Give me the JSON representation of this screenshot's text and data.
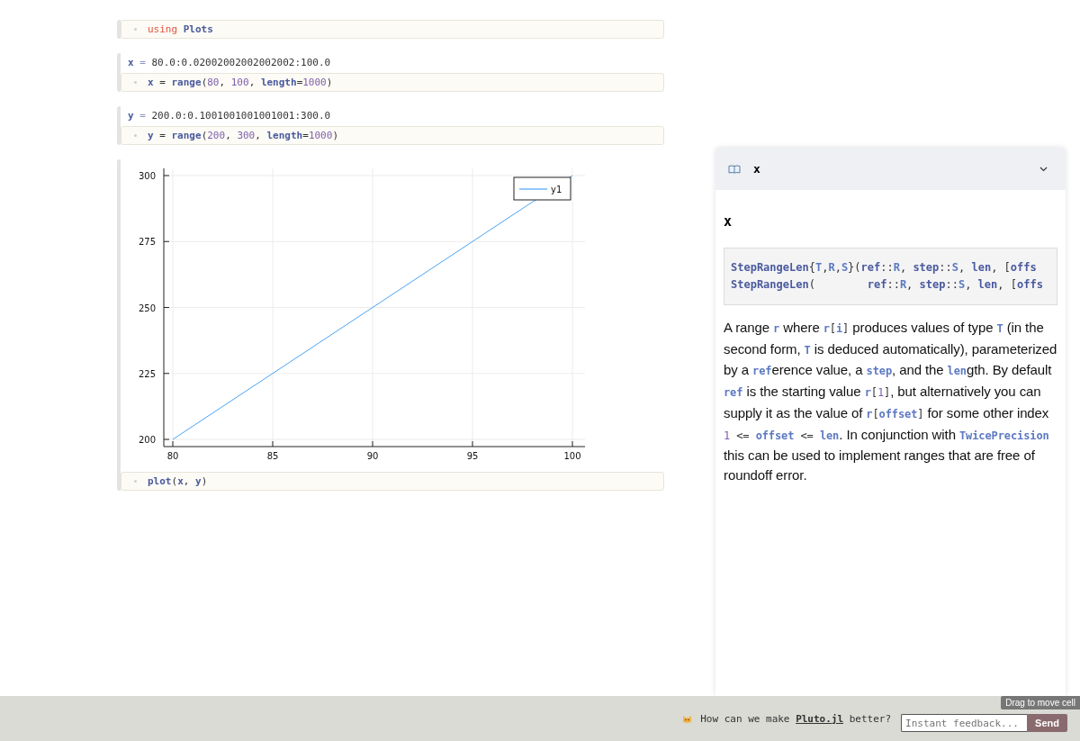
{
  "cells": [
    {
      "input": [
        {
          "kind": "keyword",
          "text": "using "
        },
        {
          "kind": "name",
          "text": "Plots"
        }
      ]
    },
    {
      "output": [
        {
          "kind": "name",
          "text": "x"
        },
        {
          "kind": "op",
          "text": " = "
        },
        {
          "kind": "plain",
          "text": "80.0:0.02002002002002002:100.0"
        }
      ],
      "input": [
        {
          "kind": "name",
          "text": "x"
        },
        {
          "kind": "plain",
          "text": " = "
        },
        {
          "kind": "name",
          "text": "range"
        },
        {
          "kind": "plain",
          "text": "("
        },
        {
          "kind": "number",
          "text": "80"
        },
        {
          "kind": "plain",
          "text": ", "
        },
        {
          "kind": "number",
          "text": "100"
        },
        {
          "kind": "plain",
          "text": ", "
        },
        {
          "kind": "name",
          "text": "length"
        },
        {
          "kind": "plain",
          "text": "="
        },
        {
          "kind": "number",
          "text": "1000"
        },
        {
          "kind": "plain",
          "text": ")"
        }
      ]
    },
    {
      "output": [
        {
          "kind": "name",
          "text": "y"
        },
        {
          "kind": "op",
          "text": " = "
        },
        {
          "kind": "plain",
          "text": "200.0:0.1001001001001001:300.0"
        }
      ],
      "input": [
        {
          "kind": "name",
          "text": "y"
        },
        {
          "kind": "plain",
          "text": " = "
        },
        {
          "kind": "name",
          "text": "range"
        },
        {
          "kind": "plain",
          "text": "("
        },
        {
          "kind": "number",
          "text": "200"
        },
        {
          "kind": "plain",
          "text": ", "
        },
        {
          "kind": "number",
          "text": "300"
        },
        {
          "kind": "plain",
          "text": ", "
        },
        {
          "kind": "name",
          "text": "length"
        },
        {
          "kind": "plain",
          "text": "="
        },
        {
          "kind": "number",
          "text": "1000"
        },
        {
          "kind": "plain",
          "text": ")"
        }
      ]
    },
    {
      "chart_data": {
        "type": "line",
        "grid": true,
        "x": [
          80,
          100
        ],
        "series": [
          {
            "name": "y1",
            "color": "#4aa3f5",
            "values": [
              200,
              300
            ]
          }
        ],
        "xlim": [
          80,
          100
        ],
        "ylim": [
          200,
          300
        ],
        "xticks": [
          80,
          85,
          90,
          95,
          100
        ],
        "yticks": [
          200,
          225,
          250,
          275,
          300
        ]
      },
      "input": [
        {
          "kind": "name",
          "text": "plot"
        },
        {
          "kind": "plain",
          "text": "("
        },
        {
          "kind": "name",
          "text": "x"
        },
        {
          "kind": "plain",
          "text": ", "
        },
        {
          "kind": "name",
          "text": "y"
        },
        {
          "kind": "plain",
          "text": ")"
        }
      ]
    }
  ],
  "docs": {
    "title": "x",
    "heading": "x",
    "signature": [
      [
        {
          "kind": "name",
          "text": "StepRangeLen"
        },
        {
          "kind": "plain",
          "text": "{"
        },
        {
          "kind": "type",
          "text": "T"
        },
        {
          "kind": "plain",
          "text": ","
        },
        {
          "kind": "type",
          "text": "R"
        },
        {
          "kind": "plain",
          "text": ","
        },
        {
          "kind": "type",
          "text": "S"
        },
        {
          "kind": "plain",
          "text": "}("
        },
        {
          "kind": "name",
          "text": "ref"
        },
        {
          "kind": "plain",
          "text": "::"
        },
        {
          "kind": "type",
          "text": "R"
        },
        {
          "kind": "plain",
          "text": ", "
        },
        {
          "kind": "name",
          "text": "step"
        },
        {
          "kind": "plain",
          "text": "::"
        },
        {
          "kind": "type",
          "text": "S"
        },
        {
          "kind": "plain",
          "text": ", "
        },
        {
          "kind": "name",
          "text": "len"
        },
        {
          "kind": "plain",
          "text": ", ["
        },
        {
          "kind": "name",
          "text": "offs"
        }
      ],
      [
        {
          "kind": "name",
          "text": "StepRangeLen"
        },
        {
          "kind": "plain",
          "text": "(        "
        },
        {
          "kind": "name",
          "text": "ref"
        },
        {
          "kind": "plain",
          "text": "::"
        },
        {
          "kind": "type",
          "text": "R"
        },
        {
          "kind": "plain",
          "text": ", "
        },
        {
          "kind": "name",
          "text": "step"
        },
        {
          "kind": "plain",
          "text": "::"
        },
        {
          "kind": "type",
          "text": "S"
        },
        {
          "kind": "plain",
          "text": ", "
        },
        {
          "kind": "name",
          "text": "len"
        },
        {
          "kind": "plain",
          "text": ", ["
        },
        {
          "kind": "name",
          "text": "offs"
        }
      ]
    ],
    "paragraph": [
      {
        "kind": "text",
        "text": "A range "
      },
      {
        "kind": "code",
        "text": "r"
      },
      {
        "kind": "text",
        "text": " where "
      },
      {
        "kind": "code",
        "text": "r"
      },
      {
        "kind": "codep",
        "text": "["
      },
      {
        "kind": "code",
        "text": "i"
      },
      {
        "kind": "codep",
        "text": "]"
      },
      {
        "kind": "text",
        "text": " produces values of type "
      },
      {
        "kind": "code",
        "text": "T"
      },
      {
        "kind": "text",
        "text": " (in the second form, "
      },
      {
        "kind": "code",
        "text": "T"
      },
      {
        "kind": "text",
        "text": " is deduced automatically), parameterized by a "
      },
      {
        "kind": "code",
        "text": "ref"
      },
      {
        "kind": "text",
        "text": "erence value, a "
      },
      {
        "kind": "code",
        "text": "step"
      },
      {
        "kind": "text",
        "text": ", and the "
      },
      {
        "kind": "code",
        "text": "len"
      },
      {
        "kind": "text",
        "text": "gth. By default "
      },
      {
        "kind": "code",
        "text": "ref"
      },
      {
        "kind": "text",
        "text": " is the starting value "
      },
      {
        "kind": "code",
        "text": "r"
      },
      {
        "kind": "codep",
        "text": "["
      },
      {
        "kind": "num",
        "text": "1"
      },
      {
        "kind": "codep",
        "text": "]"
      },
      {
        "kind": "text",
        "text": ", but alternatively you can supply it as the value of "
      },
      {
        "kind": "code",
        "text": "r"
      },
      {
        "kind": "codep",
        "text": "["
      },
      {
        "kind": "code",
        "text": "offset"
      },
      {
        "kind": "codep",
        "text": "]"
      },
      {
        "kind": "text",
        "text": " for some other index "
      },
      {
        "kind": "num",
        "text": "1"
      },
      {
        "kind": "codep",
        "text": " <= "
      },
      {
        "kind": "code",
        "text": "offset"
      },
      {
        "kind": "codep",
        "text": " <= "
      },
      {
        "kind": "code",
        "text": "len"
      },
      {
        "kind": "text",
        "text": ". In conjunction with "
      },
      {
        "kind": "code",
        "text": "TwicePrecision"
      },
      {
        "kind": "text",
        "text": " this can be used to implement ranges that are free of roundoff error."
      }
    ]
  },
  "footer": {
    "question_before": "How can we make ",
    "link": "Pluto.jl",
    "question_after": " better?",
    "placeholder": "Instant feedback...",
    "button": "Send"
  },
  "tooltip": "Drag to move cell"
}
